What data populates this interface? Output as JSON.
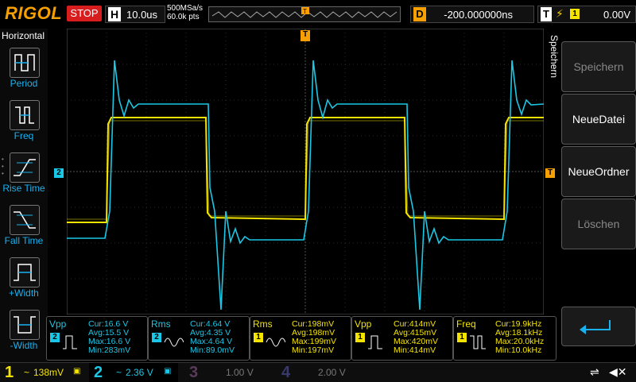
{
  "header": {
    "logo": "RIGOL",
    "run_state": "STOP",
    "timebase_label": "H",
    "timebase_value": "10.0us",
    "sample_rate": "500MSa/s",
    "memory_depth": "60.0k pts",
    "delay_label": "D",
    "delay_value": "-200.000000ns",
    "trigger_label": "T",
    "trigger_source": "1",
    "trigger_level": "0.00V"
  },
  "left_menu": {
    "title": "Horizontal",
    "items": [
      {
        "label": "Period",
        "icon": "period-icon"
      },
      {
        "label": "Freq",
        "icon": "frequency-icon"
      },
      {
        "label": "Rise Time",
        "icon": "rise-time-icon"
      },
      {
        "label": "Fall Time",
        "icon": "fall-time-icon"
      },
      {
        "label": "+Width",
        "icon": "positive-width-icon"
      },
      {
        "label": "-Width",
        "icon": "negative-width-icon"
      }
    ]
  },
  "right_menu": {
    "title": "Speichern",
    "buttons": [
      {
        "label": "Speichern",
        "enabled": false
      },
      {
        "label": "NeueDatei",
        "enabled": true
      },
      {
        "label": "NeueOrdner",
        "enabled": true
      },
      {
        "label": "Löschen",
        "enabled": false
      }
    ],
    "return_icon": "return-arrow-icon"
  },
  "markers": {
    "ch2_ground": "2",
    "trigger_level": "T",
    "trigger_position": "T"
  },
  "measurements": [
    {
      "name": "Vpp",
      "source": "2",
      "color": "#19c8e6",
      "cur": "Cur:16.6 V",
      "avg": "Avg:15.5 V",
      "max": "Max:16.6 V",
      "min": "Min:283mV"
    },
    {
      "name": "Rms",
      "source": "2",
      "color": "#19c8e6",
      "cur": "Cur:4.64 V",
      "avg": "Avg:4.35 V",
      "max": "Max:4.64 V",
      "min": "Min:89.0mV"
    },
    {
      "name": "Rms",
      "source": "1",
      "color": "#f5e400",
      "cur": "Cur:198mV",
      "avg": "Avg:198mV",
      "max": "Max:199mV",
      "min": "Min:197mV"
    },
    {
      "name": "Vpp",
      "source": "1",
      "color": "#f5e400",
      "cur": "Cur:414mV",
      "avg": "Avg:415mV",
      "max": "Max:420mV",
      "min": "Min:414mV"
    },
    {
      "name": "Freq",
      "source": "1",
      "color": "#f5e400",
      "cur": "Cur:19.9kHz",
      "avg": "Avg:18.1kHz",
      "max": "Max:20.0kHz",
      "min": "Min:10.0kHz"
    }
  ],
  "channels": [
    {
      "num": "1",
      "scale": "138mV",
      "color": "#f5e400",
      "active": true
    },
    {
      "num": "2",
      "scale": "2.36 V",
      "color": "#19c8e6",
      "active": true
    },
    {
      "num": "3",
      "scale": "1.00 V",
      "color": "#c040c0",
      "active": false
    },
    {
      "num": "4",
      "scale": "2.00 V",
      "color": "#3060ff",
      "active": false
    }
  ],
  "colors": {
    "ch1": "#f5e400",
    "ch2": "#19c8e6",
    "accent": "#f5a000",
    "stop": "#d71d1d"
  }
}
